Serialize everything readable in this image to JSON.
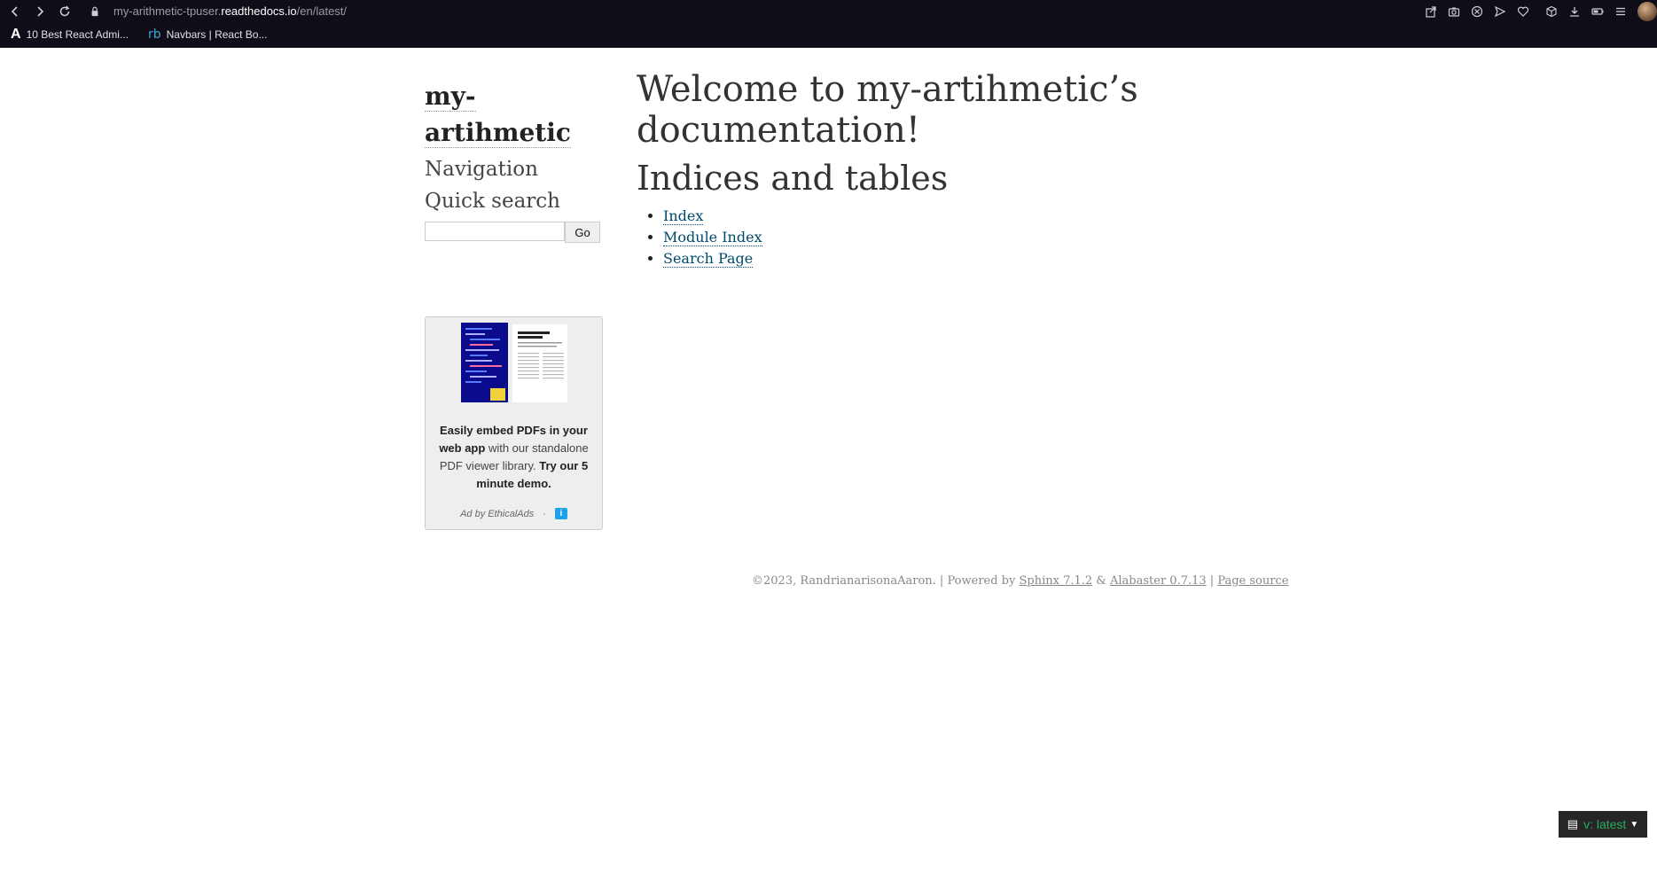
{
  "browser": {
    "url_prefix": "my-arithmetic-tpuser.",
    "url_host": "readthedocs.io",
    "url_path": "/en/latest/",
    "bookmarks": [
      {
        "icon": "A",
        "label": "10 Best React Admi..."
      },
      {
        "icon": "rb",
        "label": "Navbars | React Bo..."
      }
    ]
  },
  "sidebar": {
    "logo_line1": "my-",
    "logo_line2": "artihmetic",
    "navigation_heading": "Navigation",
    "search_heading": "Quick search",
    "search_value": "",
    "go_label": "Go"
  },
  "ad": {
    "bold1": "Easily embed PDFs in your web app",
    "plain": " with our standalone PDF viewer library. ",
    "bold2": "Try our 5 minute demo.",
    "by": "Ad by EthicalAds",
    "sep": "·",
    "info": "i"
  },
  "main": {
    "title": "Welcome to my-artihmetic’s documentation!",
    "indices_heading": "Indices and tables",
    "links": [
      "Index",
      "Module Index",
      "Search Page"
    ]
  },
  "footer": {
    "copyright": "©2023, RandrianarisonaAaron. | Powered by ",
    "sphinx": "Sphinx 7.1.2",
    "amp": " & ",
    "alabaster": "Alabaster 0.7.13",
    "pipe": " | ",
    "page_source": "Page source"
  },
  "rtd": {
    "version": "v: latest"
  },
  "colors": {
    "chrome_bg": "#0f0d17",
    "link": "#004b6b",
    "rtd_green": "#27ae60"
  }
}
